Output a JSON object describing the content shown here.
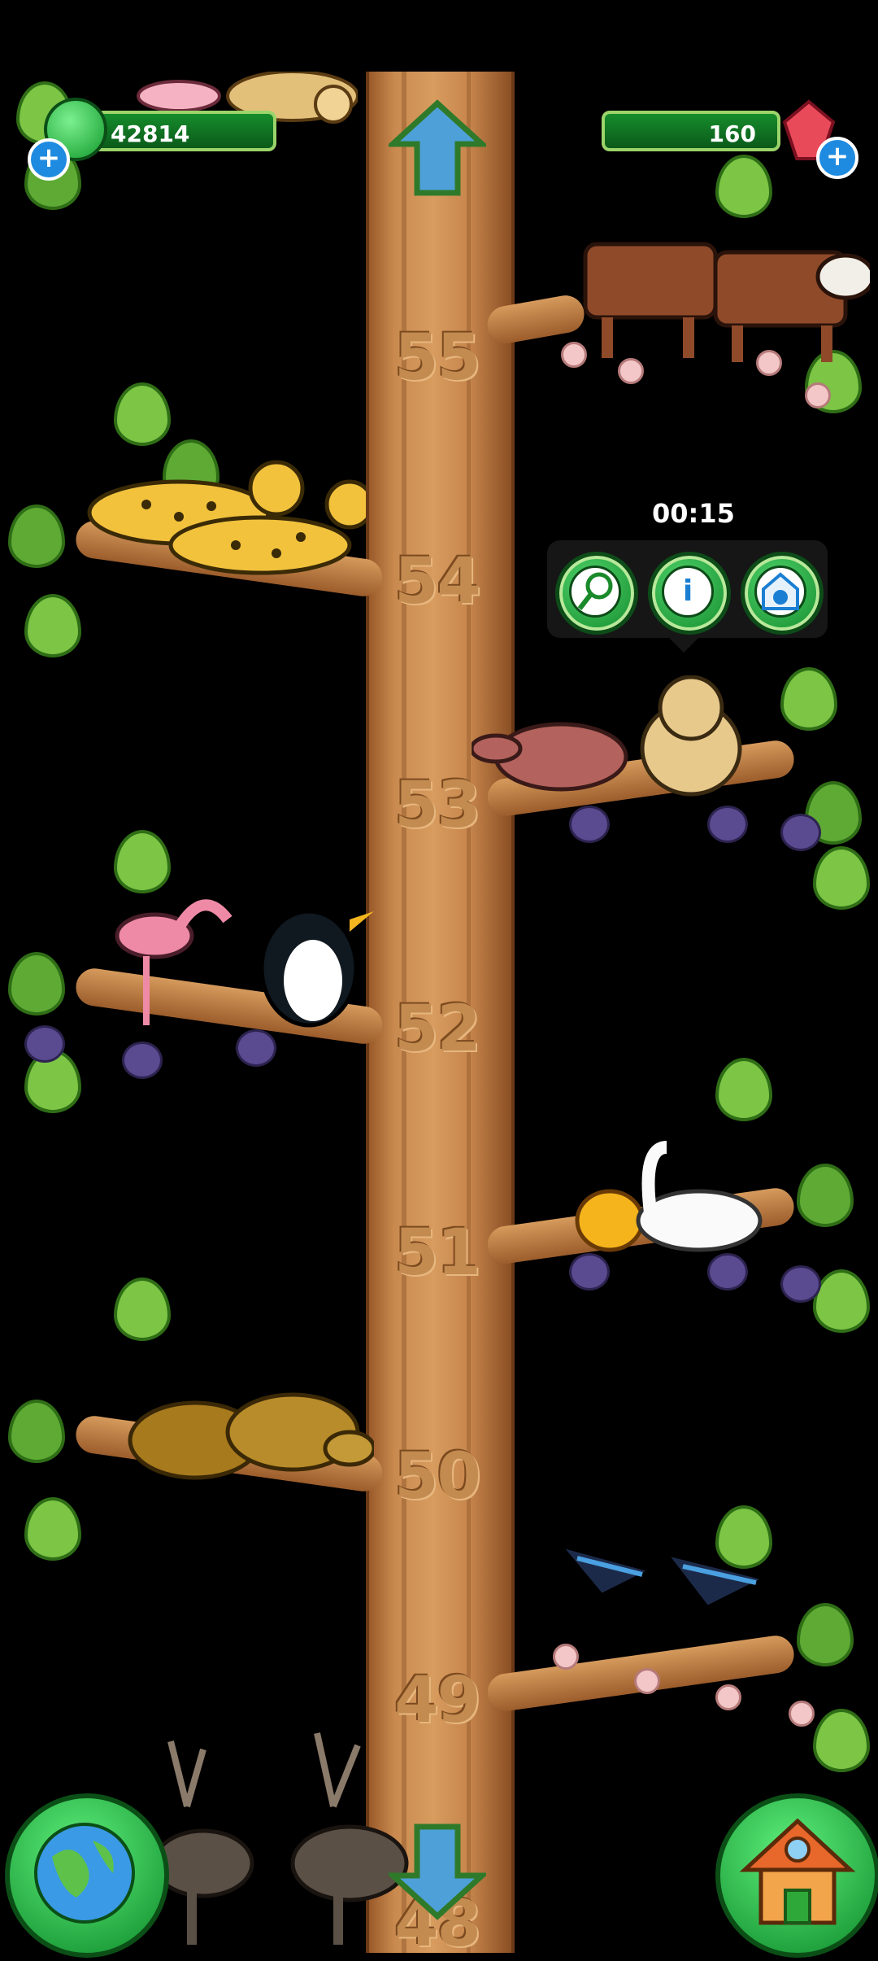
{
  "hud": {
    "coins": "42814",
    "gems": "160",
    "coin_plus": "+",
    "gem_plus": "+"
  },
  "popup": {
    "timer": "00:15",
    "buttons": [
      "net-icon",
      "info-icon",
      "animal-house-icon"
    ],
    "info_glyph": "i"
  },
  "levels": [
    "55",
    "54",
    "53",
    "52",
    "51",
    "50",
    "49",
    "48"
  ],
  "colors": {
    "trunk": "#c98a4f",
    "leaf": "#7cc545",
    "hud_green": "#168c2b",
    "button_blue": "#1e8be0"
  }
}
